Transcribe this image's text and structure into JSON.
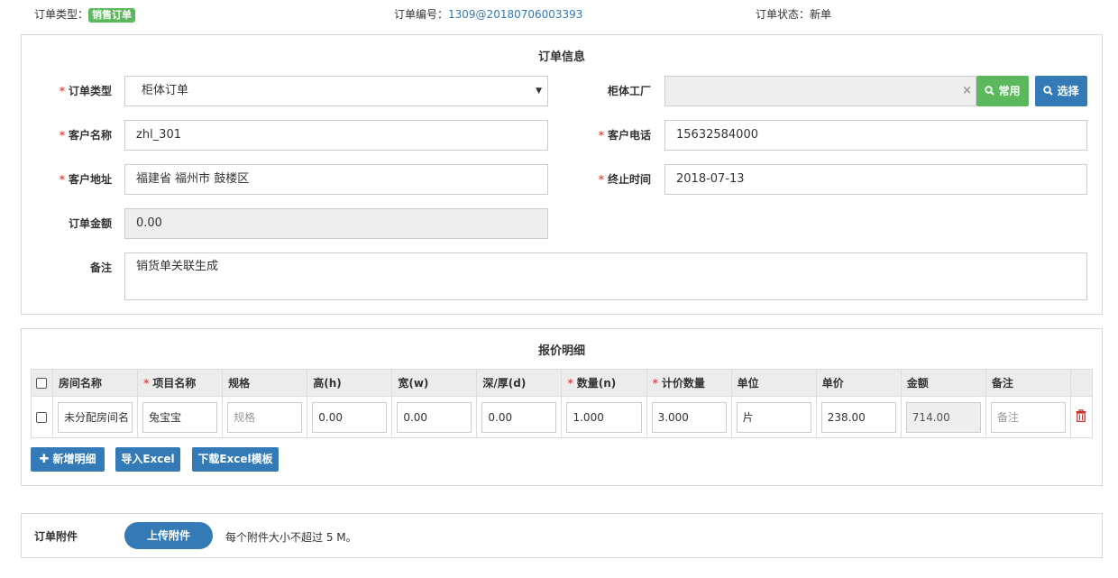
{
  "header": {
    "order_type_label": "订单类型：",
    "order_type_badge": "销售订单",
    "order_no_label": "订单编号：",
    "order_no_value": "1309@20180706003393",
    "order_status_label": "订单状态：",
    "order_status_value": "新单"
  },
  "order_info": {
    "title": "订单信息",
    "order_type": {
      "label": "订单类型",
      "value": "柜体订单"
    },
    "factory": {
      "label": "柜体工厂",
      "value": "",
      "clear_icon": "×",
      "common_button": "常用",
      "select_button": "选择"
    },
    "customer_name": {
      "label": "客户名称",
      "value": "zhl_301"
    },
    "customer_phone": {
      "label": "客户电话",
      "value": "15632584000"
    },
    "customer_address": {
      "label": "客户地址",
      "value": "福建省 福州市 鼓楼区"
    },
    "end_time": {
      "label": "终止时间",
      "value": "2018-07-13"
    },
    "order_amount": {
      "label": "订单金额",
      "value": "0.00"
    },
    "remark": {
      "label": "备注",
      "value": "销货单关联生成"
    }
  },
  "quote": {
    "title": "报价明细",
    "columns": [
      "房间名称",
      "项目名称",
      "规格",
      "高(h)",
      "宽(w)",
      "深/厚(d)",
      "数量(n)",
      "计价数量",
      "单位",
      "单价",
      "金额",
      "备注"
    ],
    "rows": [
      {
        "room": "未分配房间名",
        "item": "兔宝宝",
        "spec_placeholder": "规格",
        "height": "0.00",
        "width": "0.00",
        "depth": "0.00",
        "quantity": "1.000",
        "billing_qty": "3.000",
        "unit": "片",
        "unit_price": "238.00",
        "amount": "714.00",
        "remark_placeholder": "备注"
      }
    ],
    "add_button": "新增明细",
    "import_button": "导入Excel",
    "download_button": "下载Excel模板"
  },
  "attachment": {
    "label": "订单附件",
    "upload_button": "上传附件",
    "hint": "每个附件大小不超过 5 M。"
  },
  "colors": {
    "primary": "#337ab7",
    "success": "#5cb85c",
    "danger": "#d9534f"
  }
}
